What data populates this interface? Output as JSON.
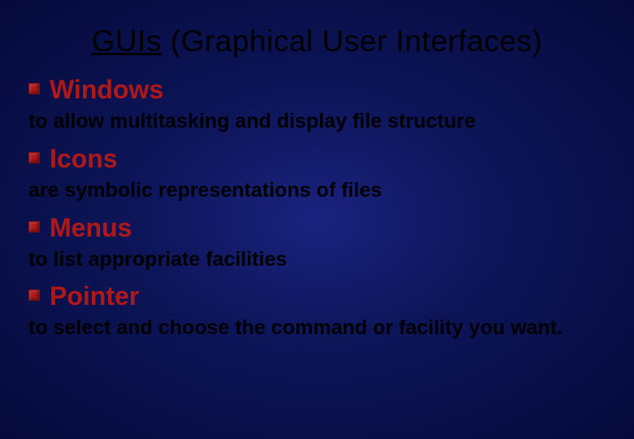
{
  "slide": {
    "title_prefix": "GUIs",
    "title_rest": " (Graphical User Interfaces)",
    "items": [
      {
        "heading": "Windows",
        "description": "to allow multitasking and display file structure"
      },
      {
        "heading": "Icons",
        "description": "are symbolic representations of files"
      },
      {
        "heading": "Menus",
        "description": "to list appropriate facilities"
      },
      {
        "heading": "Pointer",
        "description": "to select and choose the  command or facility you want."
      }
    ]
  }
}
